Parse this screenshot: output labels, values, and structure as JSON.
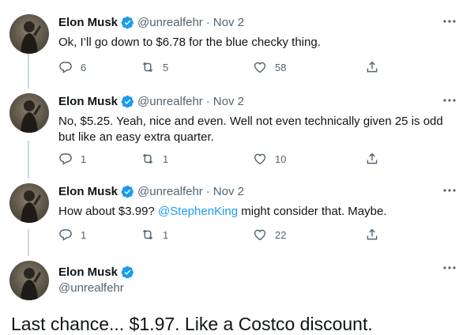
{
  "tweets": [
    {
      "name": "Elon Musk",
      "handle": "@unrealfehr",
      "date": "Nov 2",
      "text": "Ok, I’ll go down to $6.78 for the blue checky thing.",
      "replies": "6",
      "retweets": "5",
      "likes": "58"
    },
    {
      "name": "Elon Musk",
      "handle": "@unrealfehr",
      "date": "Nov 2",
      "text": "No, $5.25. Yeah, nice and even. Well not even technically given 25 is odd but like an easy extra quarter.",
      "replies": "1",
      "retweets": "1",
      "likes": "10"
    },
    {
      "name": "Elon Musk",
      "handle": "@unrealfehr",
      "date": "Nov 2",
      "text_before": "How about $3.99? ",
      "mention": "@StephenKing",
      "text_after": " might consider that. Maybe.",
      "replies": "1",
      "retweets": "1",
      "likes": "22"
    }
  ],
  "final_tweet": {
    "name": "Elon Musk",
    "handle": "@unrealfehr",
    "text": "Last chance... $1.97. Like a Costco discount."
  },
  "separator": "·",
  "colors": {
    "accent": "#1d9bf0",
    "secondary_text": "#536471",
    "thread_line": "#cfd9de"
  },
  "icons": [
    "verified-badge-icon",
    "more-options-icon",
    "reply-icon",
    "retweet-icon",
    "like-icon",
    "share-icon"
  ]
}
